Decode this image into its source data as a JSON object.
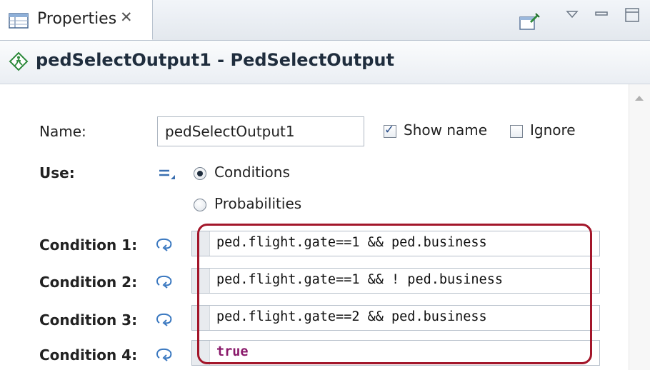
{
  "tabbar": {
    "tab_label": "Properties",
    "tab_close": "✕"
  },
  "title": {
    "text": "pedSelectOutput1 - PedSelectOutput"
  },
  "form": {
    "name_label": "Name:",
    "name_value": "pedSelectOutput1",
    "show_name_label": "Show name",
    "show_name_checked": true,
    "ignore_label": "Ignore",
    "ignore_checked": false,
    "use_label": "Use:",
    "use_options": [
      {
        "label": "Conditions",
        "selected": true
      },
      {
        "label": "Probabilities",
        "selected": false
      }
    ],
    "conditions": [
      {
        "label": "Condition 1:",
        "value": "ped.flight.gate==1 && ped.business",
        "keyword": false
      },
      {
        "label": "Condition 2:",
        "value": "ped.flight.gate==1 && ! ped.business",
        "keyword": false
      },
      {
        "label": "Condition 3:",
        "value": "ped.flight.gate==2 && ped.business",
        "keyword": false
      },
      {
        "label": "Condition 4:",
        "value": "true",
        "keyword": true
      }
    ]
  },
  "colors": {
    "highlight": "#a3162a",
    "keyword": "#8a1a6b"
  }
}
